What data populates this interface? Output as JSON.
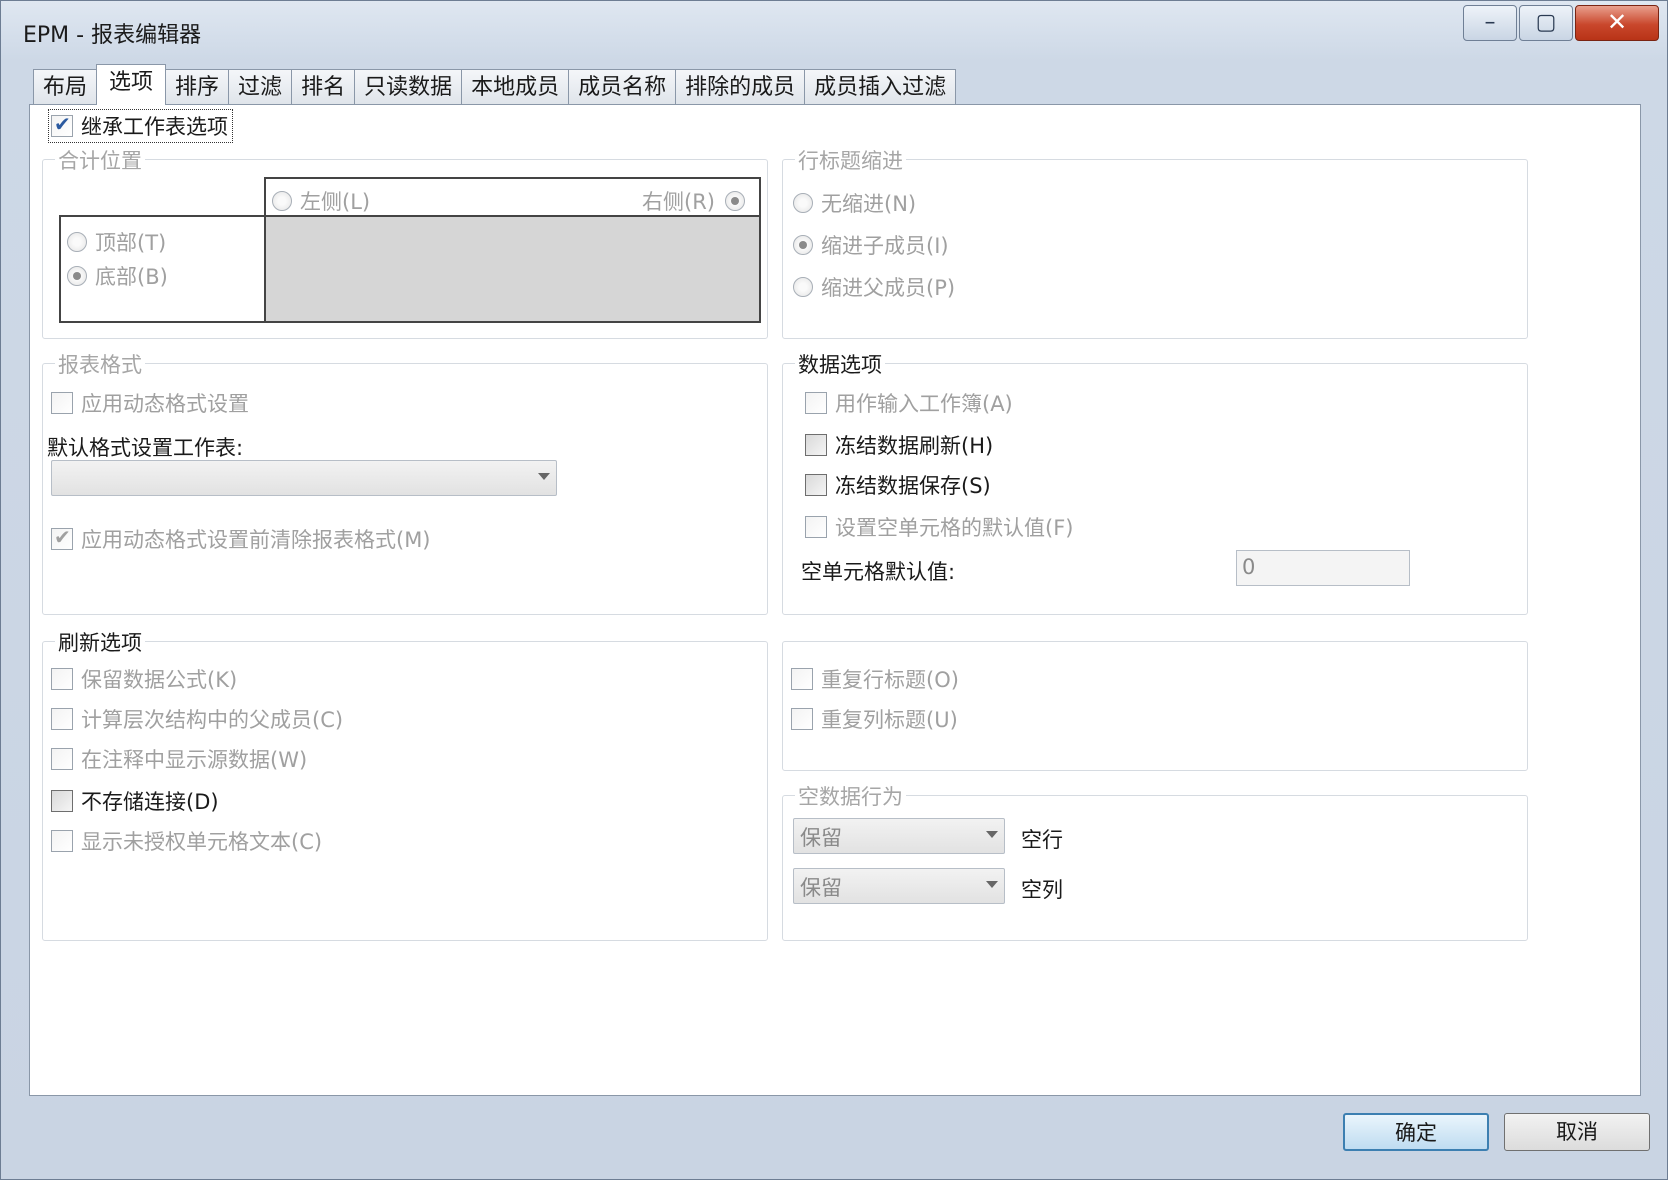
{
  "window": {
    "title": "EPM - 报表编辑器",
    "minimize_glyph": "–",
    "maximize_glyph": "▢",
    "close_glyph": "✕"
  },
  "tabs": [
    "布局",
    "选项",
    "排序",
    "过滤",
    "排名",
    "只读数据",
    "本地成员",
    "成员名称",
    "排除的成员",
    "成员插入过滤"
  ],
  "active_tab": "选项",
  "inherit_sheet_options": {
    "label": "继承工作表选项",
    "checked": true
  },
  "total_position": {
    "title": "合计位置",
    "left_label": "左侧(L)",
    "right_label": "右侧(R)",
    "top_label": "顶部(T)",
    "bottom_label": "底部(B)",
    "horizontal_selected": "右侧(R)",
    "vertical_selected": "底部(B)"
  },
  "row_header_indent": {
    "title": "行标题缩进",
    "options": [
      "无缩进(N)",
      "缩进子成员(I)",
      "缩进父成员(P)"
    ],
    "selected": "缩进子成员(I)"
  },
  "report_format": {
    "title": "报表格式",
    "apply_dynamic_label": "应用动态格式设置",
    "default_sheet_label": "默认格式设置工作表:",
    "default_sheet_value": "",
    "clear_before_label": "应用动态格式设置前清除报表格式(M)",
    "clear_before_checked": true
  },
  "data_options": {
    "title": "数据选项",
    "use_as_input_label": "用作输入工作簿(A)",
    "freeze_refresh_label": "冻结数据刷新(H)",
    "freeze_save_label": "冻结数据保存(S)",
    "empty_default_label": "设置空单元格的默认值(F)",
    "empty_value_label": "空单元格默认值:",
    "empty_value": "0"
  },
  "refresh_options": {
    "title": "刷新选项",
    "items": [
      "保留数据公式(K)",
      "计算层次结构中的父成员(C)",
      "在注释中显示源数据(W)",
      "不存储连接(D)",
      "显示未授权单元格文本(C)"
    ]
  },
  "repeat_options": {
    "repeat_row_label": "重复行标题(O)",
    "repeat_col_label": "重复列标题(U)"
  },
  "empty_data": {
    "title": "空数据行为",
    "row_value": "保留",
    "row_label": "空行",
    "col_value": "保留",
    "col_label": "空列"
  },
  "footer": {
    "ok_label": "确定",
    "cancel_label": "取消"
  }
}
